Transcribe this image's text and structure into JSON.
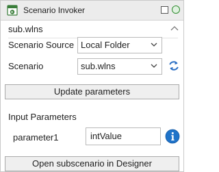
{
  "window": {
    "title": "Scenario Invoker"
  },
  "header": {
    "file_name": "sub.wlns"
  },
  "form": {
    "scenario_source_label": "Scenario Source",
    "scenario_source_value": "Local Folder",
    "scenario_label": "Scenario",
    "scenario_value": "sub.wlns"
  },
  "actions": {
    "update_label": "Update parameters",
    "open_label": "Open subscenario in Designer"
  },
  "parameters": {
    "section_label": "Input Parameters",
    "items": [
      {
        "name": "parameter1",
        "value": "intValue"
      }
    ]
  },
  "colors": {
    "accent": "#2b6fc4",
    "refresh": "#2b6fc4",
    "info": "#1f73c9"
  },
  "icons": {
    "app": "scenario-app-icon",
    "collapse": "chevron-up-icon",
    "dropdown": "chevron-down-icon",
    "refresh": "refresh-icon",
    "info": "info-icon"
  }
}
